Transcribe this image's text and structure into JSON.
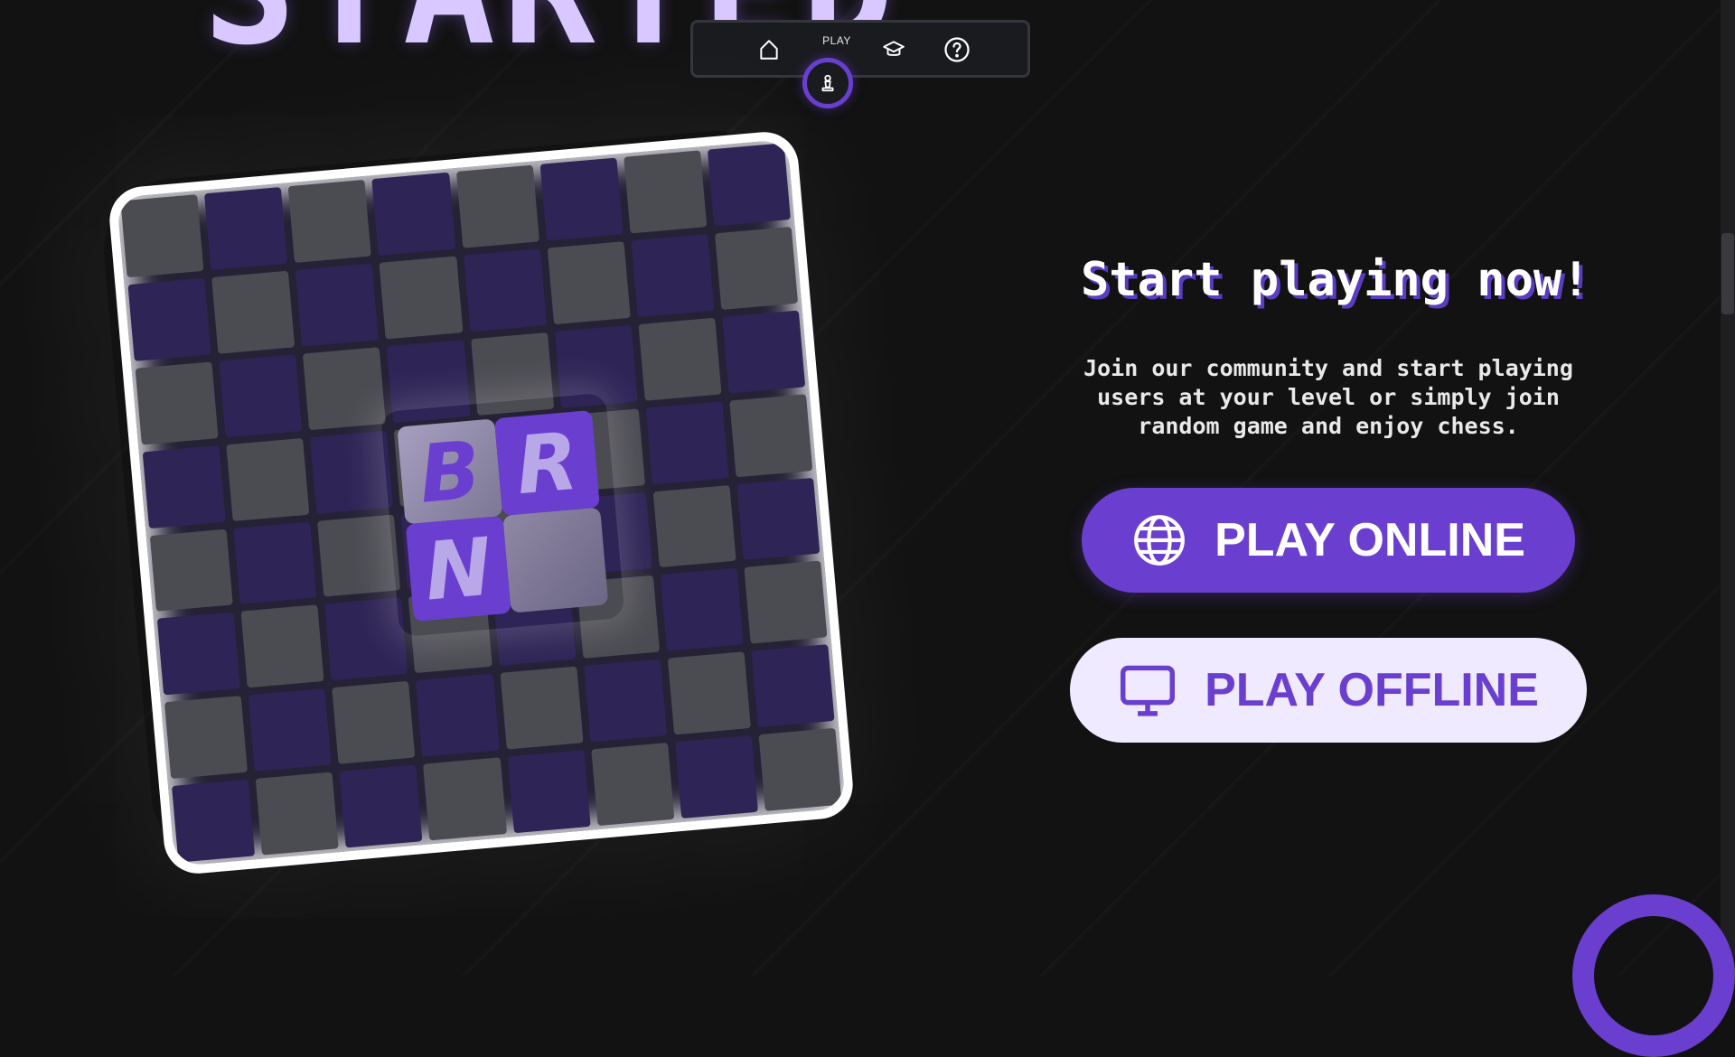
{
  "hero": {
    "word": "STARTED"
  },
  "nav": {
    "items": [
      {
        "name": "home",
        "icon": "home-icon"
      },
      {
        "name": "play",
        "label": "PLAY",
        "icon": "pawn-icon"
      },
      {
        "name": "learn",
        "icon": "graduation-cap-icon"
      },
      {
        "name": "help",
        "icon": "help-circle-icon"
      }
    ],
    "active_label": "PLAY"
  },
  "board": {
    "tiles": [
      "B",
      "R",
      "N",
      ""
    ]
  },
  "cta": {
    "title": "Start playing now!",
    "line1": "Join our community and start playing",
    "line2": "users at your level or simply join",
    "line3": "random game and enjoy chess.",
    "play_online": "PLAY ONLINE",
    "play_offline": "PLAY OFFLINE"
  },
  "colors": {
    "accent": "#6a3fd0",
    "background": "#121212",
    "offline_button_bg": "#efeaff"
  }
}
